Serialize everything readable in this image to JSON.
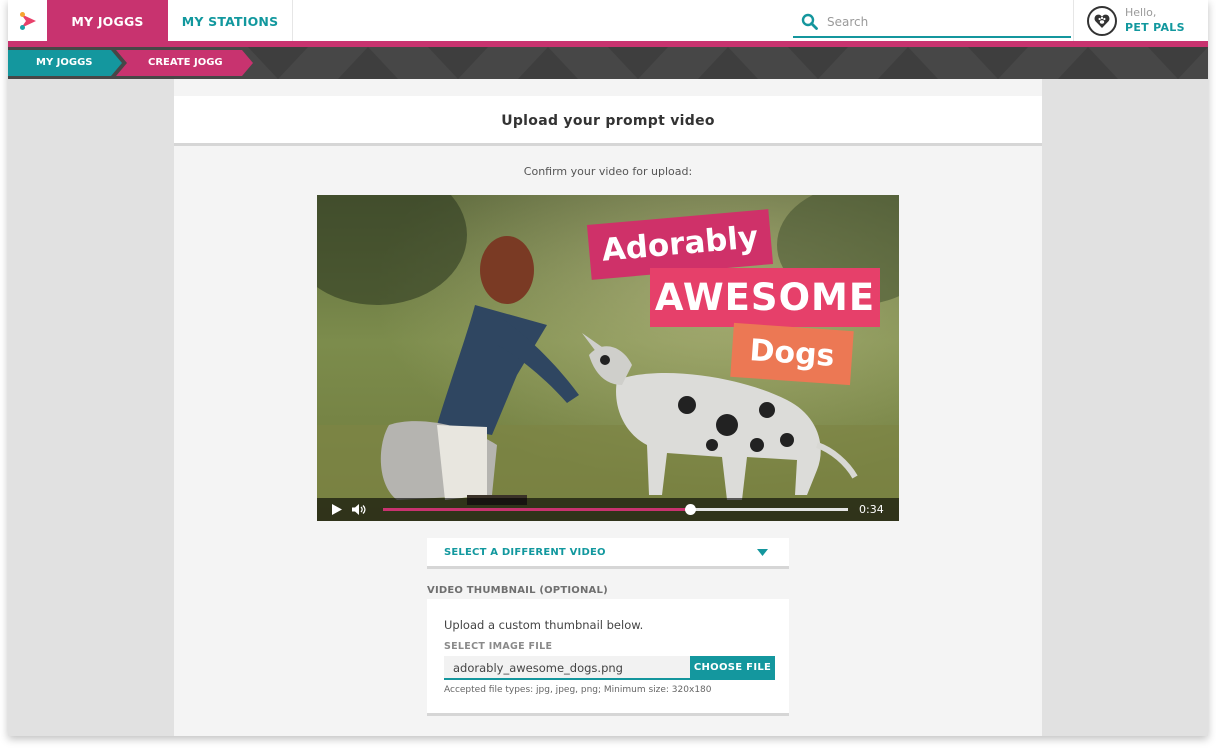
{
  "nav": {
    "tabs": [
      {
        "label": "MY JOGGS",
        "active": true
      },
      {
        "label": "MY STATIONS",
        "active": false
      }
    ],
    "search_placeholder": "Search",
    "greeting": "Hello,",
    "username": "PET PALS"
  },
  "breadcrumb": [
    "MY JOGGS",
    "CREATE JOGG"
  ],
  "page": {
    "title": "Upload your prompt video",
    "confirm_text": "Confirm your video for upload:"
  },
  "video": {
    "overlay_lines": [
      "Adorably",
      "AWESOME",
      "Dogs"
    ],
    "progress": 0.66,
    "time": "0:34"
  },
  "select_video": {
    "label": "SELECT A DIFFERENT VIDEO"
  },
  "thumbnail": {
    "heading": "VIDEO THUMBNAIL (OPTIONAL)",
    "description": "Upload a custom thumbnail below.",
    "field_label": "SELECT IMAGE FILE",
    "file_name": "adorably_awesome_dogs.png",
    "button_label": "CHOOSE FILE",
    "accepted_types": "Accepted file types: jpg, jpeg, png; Minimum size: 320x180"
  },
  "colors": {
    "brand_pink": "#c8336f",
    "brand_teal": "#14979e",
    "crumb_bar": "#474747"
  }
}
